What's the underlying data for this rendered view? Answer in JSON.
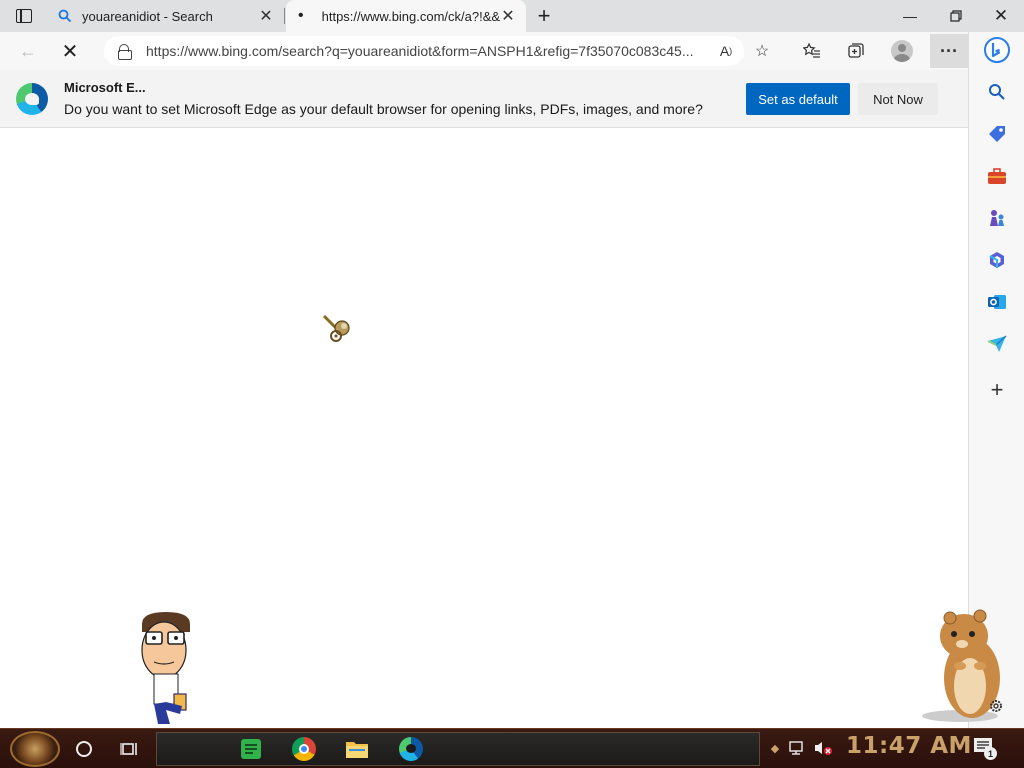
{
  "tabs": [
    {
      "title": "youareanidiot - Search",
      "icon": "search-icon"
    },
    {
      "title": "https://www.bing.com/ck/a?!&&",
      "icon": "loading-dot-icon"
    }
  ],
  "address_bar": {
    "url": "https://www.bing.com/search?q=youareanidiot&form=ANSPH1&refig=7f35070c083c45..."
  },
  "infobar": {
    "title": "Microsoft E...",
    "message": "Do you want to set Microsoft Edge as your default browser for opening links, PDFs, images, and more?",
    "primary_button": "Set as default",
    "secondary_button": "Not Now"
  },
  "taskbar": {
    "clock": "11:47 AM",
    "notification_count": "1"
  },
  "colors": {
    "accent": "#0067c0",
    "clock": "#c9a26a",
    "taskbar": "#2a0f0a"
  }
}
